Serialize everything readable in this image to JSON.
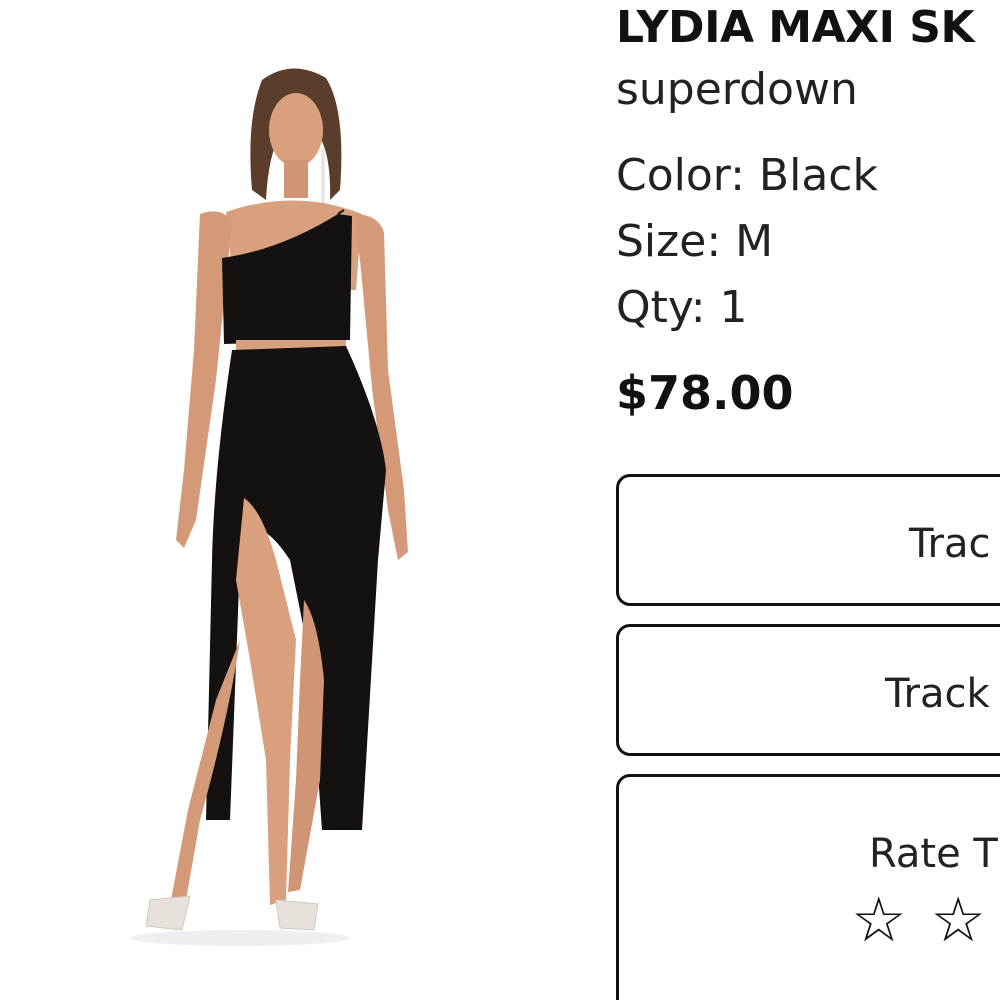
{
  "product": {
    "title": "LYDIA MAXI SK",
    "brand": "superdown",
    "color_label": "Color: Black",
    "size_label": "Size: M",
    "qty_label": "Qty: 1",
    "price": "$78.00"
  },
  "actions": {
    "track_1_label": "Trac",
    "track_2_label": "Track",
    "rate_label": "Rate T"
  },
  "rating": {
    "value": 0,
    "visible_stars": [
      "☆",
      "☆"
    ]
  },
  "colors": {
    "text": "#111111",
    "border": "#111111",
    "background": "#ffffff",
    "garment": "#141110",
    "skin": "#d9a07e"
  },
  "image": {
    "subject": "product-photo-model-black-two-piece"
  }
}
